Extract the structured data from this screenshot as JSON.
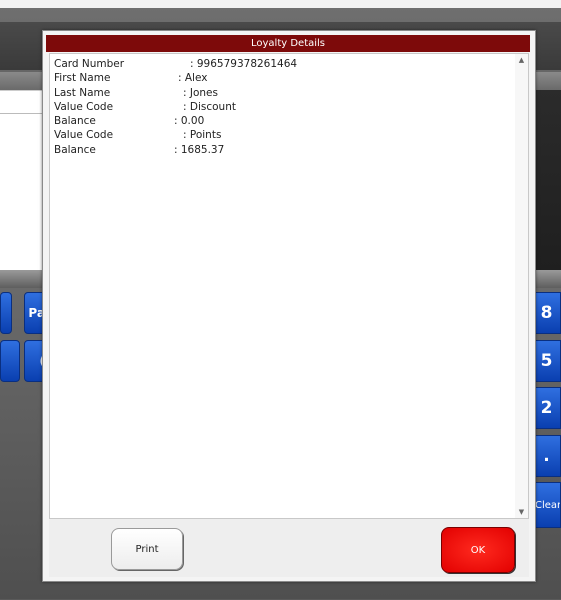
{
  "dialog": {
    "title": "Loyalty Details",
    "fields": [
      {
        "label": "Card Number",
        "value": ": 996579378261464"
      },
      {
        "label": "First Name",
        "value": ": Alex"
      },
      {
        "label": "Last Name",
        "value": ": Jones"
      },
      {
        "label": "Value Code",
        "value": ": Discount"
      },
      {
        "label": "Balance",
        "value": ": 0.00"
      },
      {
        "label": "Value Code",
        "value": ": Points"
      },
      {
        "label": "Balance",
        "value": ": 1685.37"
      }
    ],
    "print_label": "Print",
    "ok_label": "OK"
  },
  "background": {
    "left_buttons": [
      "Pa",
      "("
    ],
    "keypad": [
      "8",
      "5",
      "2",
      "."
    ],
    "clear_label": "Clear"
  },
  "colors": {
    "title_bar": "#7d0a0a",
    "ok_button": "#ff0000",
    "keypad_blue": "#1a52c8"
  }
}
